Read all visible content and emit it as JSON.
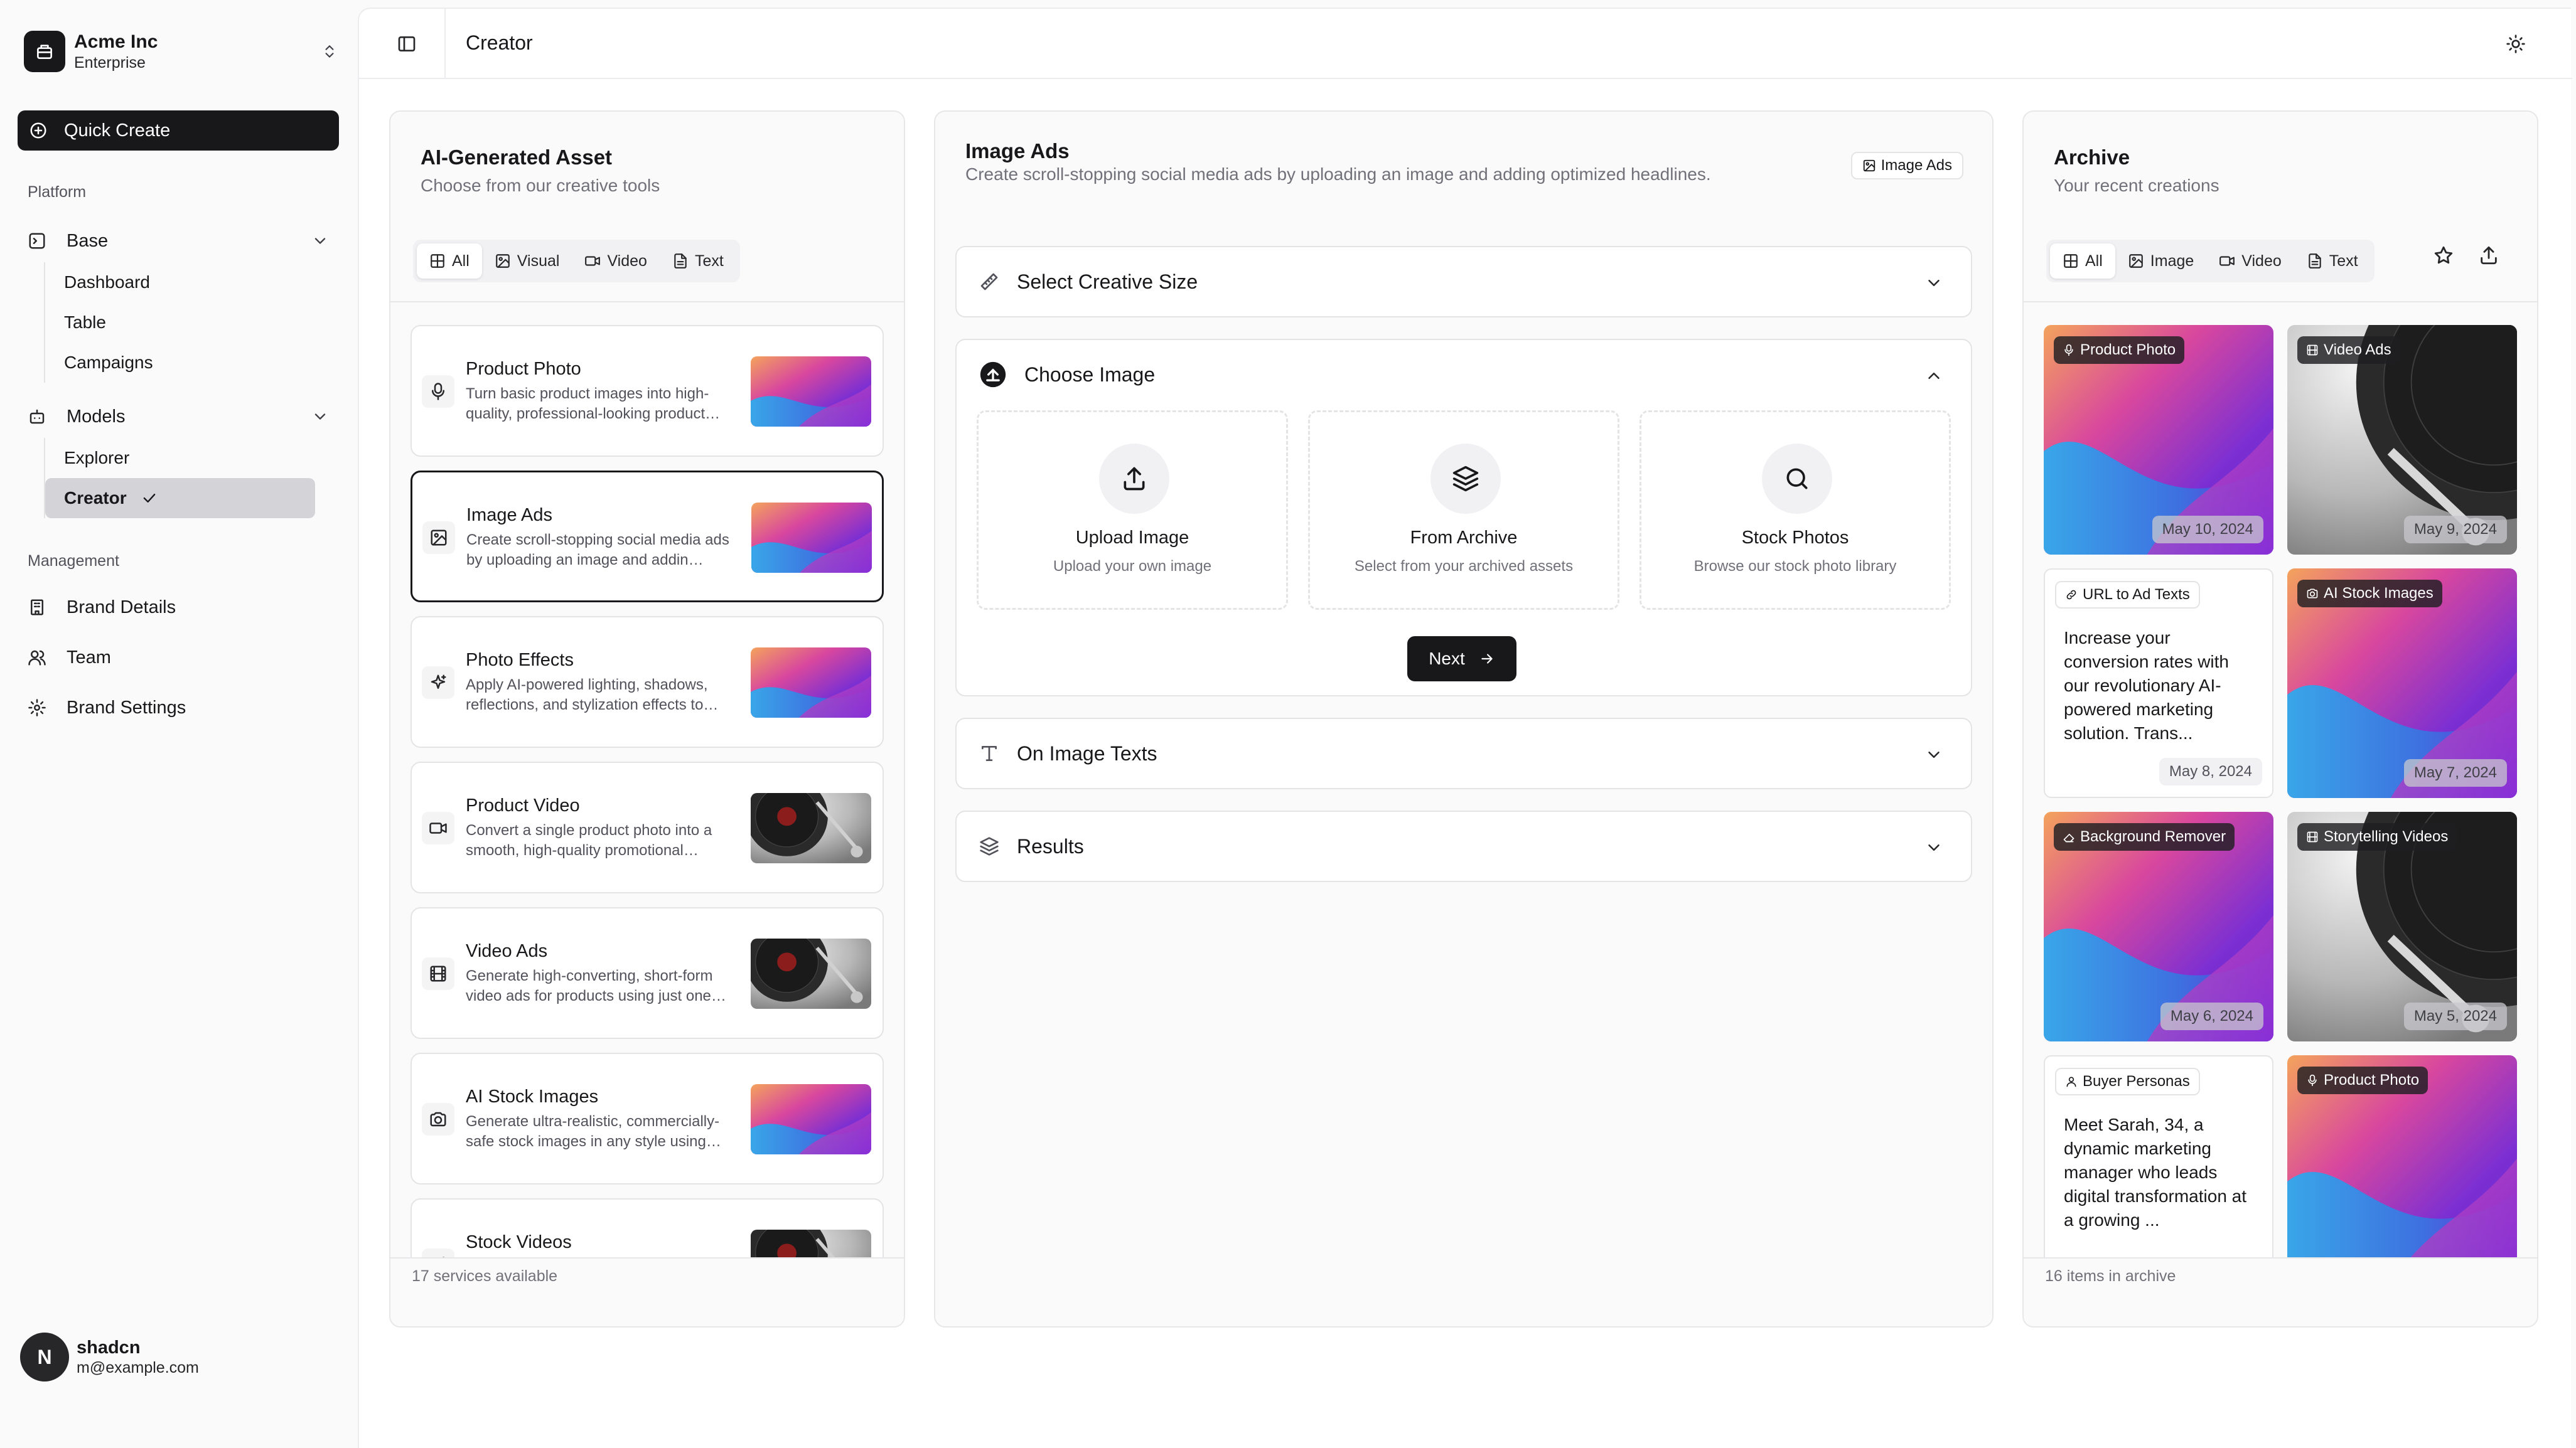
{
  "team": {
    "name": "Acme Inc",
    "plan": "Enterprise"
  },
  "quick_create": "Quick Create",
  "nav": {
    "platform_label": "Platform",
    "base": {
      "label": "Base",
      "items": [
        "Dashboard",
        "Table",
        "Campaigns"
      ]
    },
    "models": {
      "label": "Models",
      "items": [
        "Explorer",
        "Creator"
      ]
    },
    "management_label": "Management",
    "management": [
      "Brand Details",
      "Team",
      "Brand Settings"
    ]
  },
  "user": {
    "initial": "N",
    "name": "shadcn",
    "email": "m@example.com"
  },
  "header": {
    "title": "Creator"
  },
  "assets": {
    "title": "AI-Generated Asset",
    "subtitle": "Choose from our creative tools",
    "tabs": [
      "All",
      "Visual",
      "Video",
      "Text"
    ],
    "services": [
      {
        "title": "Product Photo",
        "desc": "Turn basic product images into high-quality, professional-looking product…",
        "thumb": "gradient"
      },
      {
        "title": "Image Ads",
        "desc": "Create scroll-stopping social media ads by uploading an image and addin…",
        "thumb": "gradient"
      },
      {
        "title": "Photo Effects",
        "desc": "Apply AI-powered lighting, shadows, reflections, and stylization effects to…",
        "thumb": "gradient"
      },
      {
        "title": "Product Video",
        "desc": "Convert a single product photo into a smooth, high-quality promotional…",
        "thumb": "vinyl"
      },
      {
        "title": "Video Ads",
        "desc": "Generate high-converting, short-form video ads for products using just one…",
        "thumb": "vinyl"
      },
      {
        "title": "AI Stock Images",
        "desc": "Generate ultra-realistic, commercially-safe stock images in any style using…",
        "thumb": "gradient"
      },
      {
        "title": "Stock Videos",
        "desc": "",
        "thumb": "vinyl"
      }
    ],
    "footer": "17 services available"
  },
  "image_ads": {
    "title": "Image Ads",
    "subtitle": "Create scroll-stopping social media ads by uploading an image and adding optimized headlines.",
    "badge": "Image Ads",
    "sections": {
      "size": "Select Creative Size",
      "choose": "Choose Image",
      "texts": "On Image Texts",
      "results": "Results"
    },
    "options": [
      {
        "title": "Upload Image",
        "desc": "Upload your own image"
      },
      {
        "title": "From Archive",
        "desc": "Select from your archived assets"
      },
      {
        "title": "Stock Photos",
        "desc": "Browse our stock photo library"
      }
    ],
    "next": "Next"
  },
  "archive": {
    "title": "Archive",
    "subtitle": "Your recent creations",
    "tabs": [
      "All",
      "Image",
      "Video",
      "Text"
    ],
    "items": [
      {
        "tag": "Product Photo",
        "date": "May 10, 2024",
        "kind": "gradient"
      },
      {
        "tag": "Video Ads",
        "date": "May 9, 2024",
        "kind": "vinyl"
      },
      {
        "tag": "URL to Ad Texts",
        "date": "May 8, 2024",
        "kind": "text",
        "text": "Increase your conversion rates with our revolutionary AI-powered marketing solution. Trans..."
      },
      {
        "tag": "AI Stock Images",
        "date": "May 7, 2024",
        "kind": "gradient"
      },
      {
        "tag": "Background Remover",
        "date": "May 6, 2024",
        "kind": "gradient"
      },
      {
        "tag": "Storytelling Videos",
        "date": "May 5, 2024",
        "kind": "vinyl"
      },
      {
        "tag": "Buyer Personas",
        "date": "",
        "kind": "text",
        "text": "Meet Sarah, 34, a dynamic marketing manager who leads digital transformation at a growing ..."
      },
      {
        "tag": "Product Photo",
        "date": "",
        "kind": "gradient"
      }
    ],
    "footer": "16 items in archive"
  }
}
